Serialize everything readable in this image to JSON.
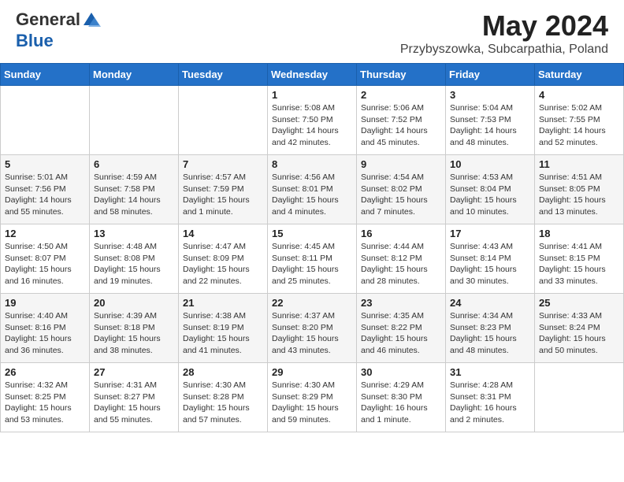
{
  "header": {
    "logo_line1": "General",
    "logo_line2": "Blue",
    "month": "May 2024",
    "location": "Przybyszowka, Subcarpathia, Poland"
  },
  "weekdays": [
    "Sunday",
    "Monday",
    "Tuesday",
    "Wednesday",
    "Thursday",
    "Friday",
    "Saturday"
  ],
  "weeks": [
    [
      {
        "day": "",
        "info": ""
      },
      {
        "day": "",
        "info": ""
      },
      {
        "day": "",
        "info": ""
      },
      {
        "day": "1",
        "info": "Sunrise: 5:08 AM\nSunset: 7:50 PM\nDaylight: 14 hours\nand 42 minutes."
      },
      {
        "day": "2",
        "info": "Sunrise: 5:06 AM\nSunset: 7:52 PM\nDaylight: 14 hours\nand 45 minutes."
      },
      {
        "day": "3",
        "info": "Sunrise: 5:04 AM\nSunset: 7:53 PM\nDaylight: 14 hours\nand 48 minutes."
      },
      {
        "day": "4",
        "info": "Sunrise: 5:02 AM\nSunset: 7:55 PM\nDaylight: 14 hours\nand 52 minutes."
      }
    ],
    [
      {
        "day": "5",
        "info": "Sunrise: 5:01 AM\nSunset: 7:56 PM\nDaylight: 14 hours\nand 55 minutes."
      },
      {
        "day": "6",
        "info": "Sunrise: 4:59 AM\nSunset: 7:58 PM\nDaylight: 14 hours\nand 58 minutes."
      },
      {
        "day": "7",
        "info": "Sunrise: 4:57 AM\nSunset: 7:59 PM\nDaylight: 15 hours\nand 1 minute."
      },
      {
        "day": "8",
        "info": "Sunrise: 4:56 AM\nSunset: 8:01 PM\nDaylight: 15 hours\nand 4 minutes."
      },
      {
        "day": "9",
        "info": "Sunrise: 4:54 AM\nSunset: 8:02 PM\nDaylight: 15 hours\nand 7 minutes."
      },
      {
        "day": "10",
        "info": "Sunrise: 4:53 AM\nSunset: 8:04 PM\nDaylight: 15 hours\nand 10 minutes."
      },
      {
        "day": "11",
        "info": "Sunrise: 4:51 AM\nSunset: 8:05 PM\nDaylight: 15 hours\nand 13 minutes."
      }
    ],
    [
      {
        "day": "12",
        "info": "Sunrise: 4:50 AM\nSunset: 8:07 PM\nDaylight: 15 hours\nand 16 minutes."
      },
      {
        "day": "13",
        "info": "Sunrise: 4:48 AM\nSunset: 8:08 PM\nDaylight: 15 hours\nand 19 minutes."
      },
      {
        "day": "14",
        "info": "Sunrise: 4:47 AM\nSunset: 8:09 PM\nDaylight: 15 hours\nand 22 minutes."
      },
      {
        "day": "15",
        "info": "Sunrise: 4:45 AM\nSunset: 8:11 PM\nDaylight: 15 hours\nand 25 minutes."
      },
      {
        "day": "16",
        "info": "Sunrise: 4:44 AM\nSunset: 8:12 PM\nDaylight: 15 hours\nand 28 minutes."
      },
      {
        "day": "17",
        "info": "Sunrise: 4:43 AM\nSunset: 8:14 PM\nDaylight: 15 hours\nand 30 minutes."
      },
      {
        "day": "18",
        "info": "Sunrise: 4:41 AM\nSunset: 8:15 PM\nDaylight: 15 hours\nand 33 minutes."
      }
    ],
    [
      {
        "day": "19",
        "info": "Sunrise: 4:40 AM\nSunset: 8:16 PM\nDaylight: 15 hours\nand 36 minutes."
      },
      {
        "day": "20",
        "info": "Sunrise: 4:39 AM\nSunset: 8:18 PM\nDaylight: 15 hours\nand 38 minutes."
      },
      {
        "day": "21",
        "info": "Sunrise: 4:38 AM\nSunset: 8:19 PM\nDaylight: 15 hours\nand 41 minutes."
      },
      {
        "day": "22",
        "info": "Sunrise: 4:37 AM\nSunset: 8:20 PM\nDaylight: 15 hours\nand 43 minutes."
      },
      {
        "day": "23",
        "info": "Sunrise: 4:35 AM\nSunset: 8:22 PM\nDaylight: 15 hours\nand 46 minutes."
      },
      {
        "day": "24",
        "info": "Sunrise: 4:34 AM\nSunset: 8:23 PM\nDaylight: 15 hours\nand 48 minutes."
      },
      {
        "day": "25",
        "info": "Sunrise: 4:33 AM\nSunset: 8:24 PM\nDaylight: 15 hours\nand 50 minutes."
      }
    ],
    [
      {
        "day": "26",
        "info": "Sunrise: 4:32 AM\nSunset: 8:25 PM\nDaylight: 15 hours\nand 53 minutes."
      },
      {
        "day": "27",
        "info": "Sunrise: 4:31 AM\nSunset: 8:27 PM\nDaylight: 15 hours\nand 55 minutes."
      },
      {
        "day": "28",
        "info": "Sunrise: 4:30 AM\nSunset: 8:28 PM\nDaylight: 15 hours\nand 57 minutes."
      },
      {
        "day": "29",
        "info": "Sunrise: 4:30 AM\nSunset: 8:29 PM\nDaylight: 15 hours\nand 59 minutes."
      },
      {
        "day": "30",
        "info": "Sunrise: 4:29 AM\nSunset: 8:30 PM\nDaylight: 16 hours\nand 1 minute."
      },
      {
        "day": "31",
        "info": "Sunrise: 4:28 AM\nSunset: 8:31 PM\nDaylight: 16 hours\nand 2 minutes."
      },
      {
        "day": "",
        "info": ""
      }
    ]
  ]
}
